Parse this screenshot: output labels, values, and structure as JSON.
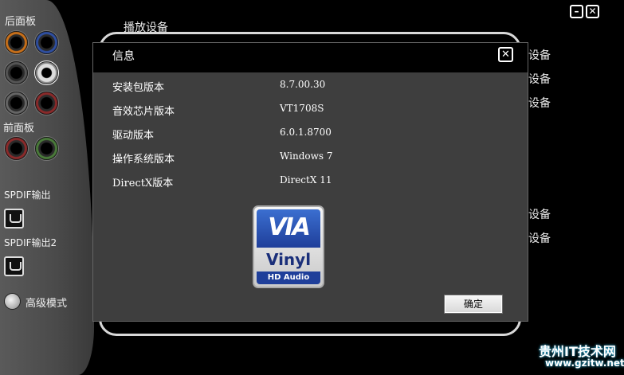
{
  "left_panel": {
    "rear_label": "后面板",
    "front_label": "前面板",
    "spdif_out_label": "SPDIF输出",
    "spdif_out2_label": "SPDIF输出2",
    "advanced_mode_label": "高级模式"
  },
  "background": {
    "playback_devices_label": "播放设备",
    "partial_labels": [
      "设备",
      "设备",
      "设备",
      "设备",
      "设备"
    ]
  },
  "dialog": {
    "title": "信息",
    "rows": [
      {
        "label": "安装包版本",
        "value": "8.7.00.30"
      },
      {
        "label": "音效芯片版本",
        "value": "VT1708S"
      },
      {
        "label": "驱动版本",
        "value": "6.0.1.8700"
      },
      {
        "label": "操作系统版本",
        "value": "Windows 7"
      },
      {
        "label": "DirectX版本",
        "value": "DirectX 11"
      }
    ],
    "logo": {
      "brand": "VIA",
      "product": "Vinyl",
      "sub": "HD Audio"
    },
    "ok_label": "确定",
    "close_glyph": "✕"
  },
  "window": {
    "minimize_glyph": "–",
    "close_glyph": "✕"
  },
  "watermark": {
    "title": "贵州IT技术网",
    "url": "www.gzitw.net"
  },
  "colors": {
    "jack_orange": "#c8701a",
    "jack_blue": "#2f4fa0",
    "jack_red": "#8a2a2a",
    "jack_green": "#4a7a3a"
  }
}
